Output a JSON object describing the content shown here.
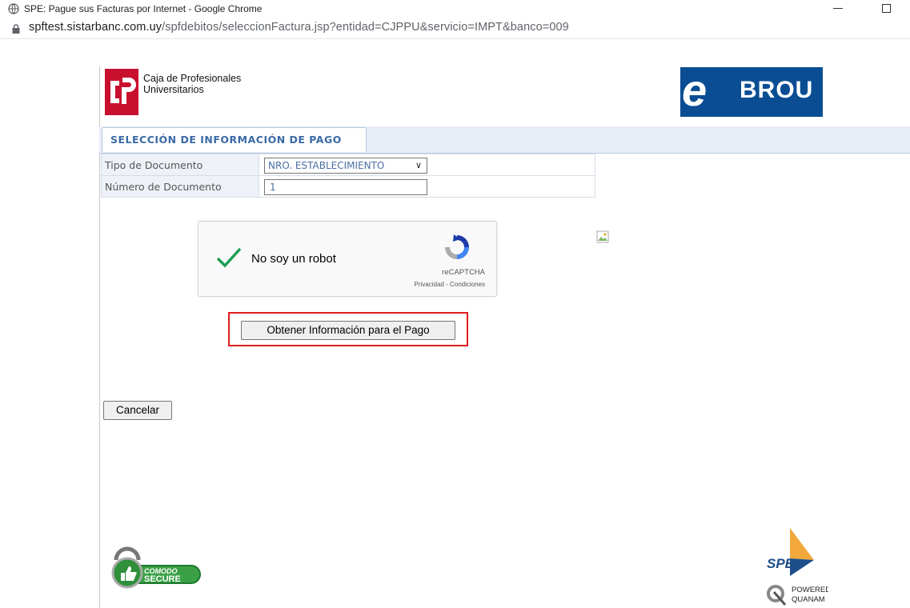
{
  "browser": {
    "window_title": "SPE: Pague sus Facturas por Internet - Google Chrome",
    "url_host": "spftest.sistarbanc.com.uy",
    "url_path": "/spfdebitos/seleccionFactura.jsp?entidad=CJPPU&servicio=IMPT&banco=009"
  },
  "header": {
    "org_line1": "Caja de Profesionales",
    "org_line2": "Universitarios",
    "bank_name": "BROU",
    "bank_letter": "e"
  },
  "tab": {
    "label": "SELECCIÓN DE INFORMACIÓN DE PAGO"
  },
  "form": {
    "doc_type_label": "Tipo de Documento",
    "doc_type_value": "NRO. ESTABLECIMIENTO",
    "doc_number_label": "Número de Documento",
    "doc_number_value": "1"
  },
  "recaptcha": {
    "label": "No soy un robot",
    "brand": "reCAPTCHA",
    "links": "Privacidad - Condiciones"
  },
  "buttons": {
    "obtener": "Obtener Información para el Pago",
    "cancelar": "Cancelar"
  },
  "footer": {
    "comodo_top": "COMODO",
    "comodo_bottom": "SECURE",
    "spe_label": "SPE",
    "powered_by": "POWERED BY",
    "quanam": "QUANAM"
  },
  "colors": {
    "highlight": "#e01c1c",
    "brou_blue": "#0a4d93",
    "cjp_red": "#c8102e",
    "tab_text": "#3a6aa6"
  }
}
